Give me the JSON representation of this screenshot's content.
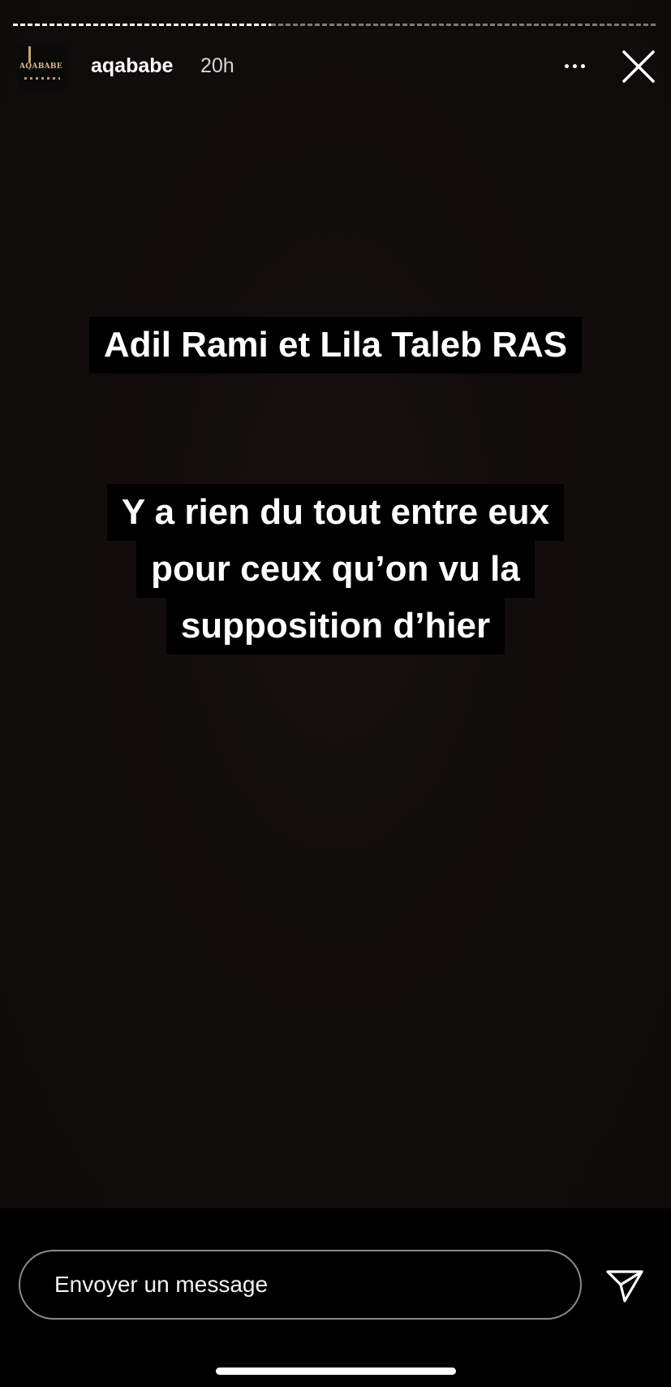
{
  "story": {
    "progress": 0.4,
    "username": "aqababe",
    "timestamp": "20h",
    "avatar_text": "AQABABE",
    "captions": [
      [
        "Adil Rami et Lila Taleb RAS"
      ],
      [
        "Y a rien du tout entre eux",
        "pour ceux qu’on vu la",
        "supposition d’hier"
      ]
    ]
  },
  "footer": {
    "message_placeholder": "Envoyer un message"
  },
  "icons": {
    "more": "more-horizontal-icon",
    "close": "close-icon",
    "send": "send-paper-plane-icon"
  }
}
